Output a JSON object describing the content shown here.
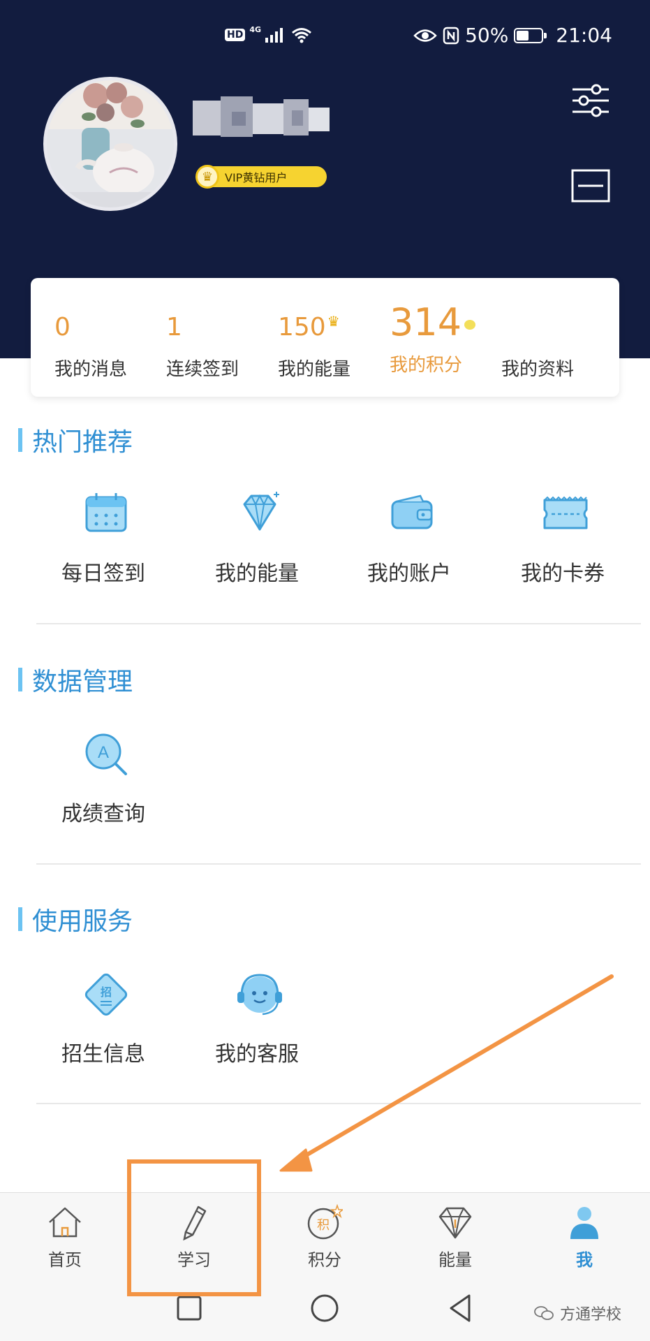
{
  "status_bar": {
    "hd": "HD",
    "network": "4G",
    "battery": "50%",
    "battery_level": 0.5,
    "time": "21:04"
  },
  "profile": {
    "vip_label": "VIP黄钻用户",
    "icons": [
      "settings-sliders-icon",
      "scan-icon",
      "trophy-icon"
    ]
  },
  "stats": [
    {
      "value": "0",
      "label": "我的消息"
    },
    {
      "value": "1",
      "label": "连续签到"
    },
    {
      "value": "150",
      "label": "我的能量"
    },
    {
      "value": "314",
      "label": "我的积分"
    },
    {
      "value": "",
      "label": "我的资料"
    }
  ],
  "sections": [
    {
      "title": "热门推荐",
      "items": [
        {
          "label": "每日签到",
          "icon": "calendar-icon"
        },
        {
          "label": "我的能量",
          "icon": "diamond-icon"
        },
        {
          "label": "我的账户",
          "icon": "wallet-icon"
        },
        {
          "label": "我的卡券",
          "icon": "ticket-icon"
        }
      ]
    },
    {
      "title": "数据管理",
      "items": [
        {
          "label": "成绩查询",
          "icon": "grade-search-icon"
        }
      ]
    },
    {
      "title": "使用服务",
      "items": [
        {
          "label": "招生信息",
          "icon": "enrollment-icon"
        },
        {
          "label": "我的客服",
          "icon": "customer-service-icon"
        }
      ]
    }
  ],
  "tabs": [
    {
      "label": "首页",
      "icon": "home-icon",
      "active": false
    },
    {
      "label": "学习",
      "icon": "pencil-icon",
      "active": false
    },
    {
      "label": "积分",
      "icon": "points-icon",
      "active": false,
      "icon_text": "积"
    },
    {
      "label": "能量",
      "icon": "diamond-icon",
      "active": false
    },
    {
      "label": "我",
      "icon": "person-icon",
      "active": true
    }
  ],
  "watermark": "方通学校",
  "colors": {
    "header_bg": "#121c3f",
    "accent_orange": "#e89a3c",
    "section_blue": "#2f8fd3",
    "icon_blue": "#6cc3f2",
    "annotation_orange": "#f39444"
  }
}
